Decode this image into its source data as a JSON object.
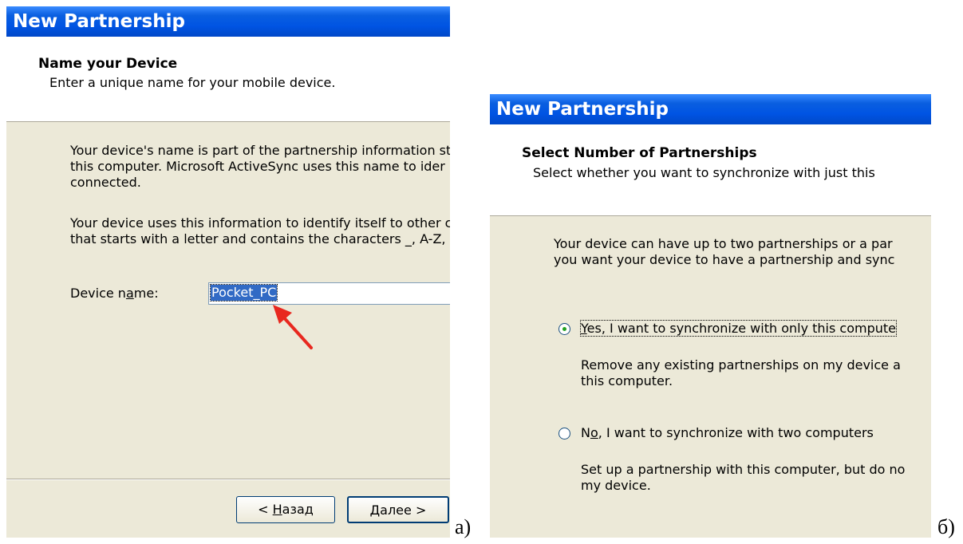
{
  "dialog_a": {
    "title": "New Partnership",
    "header_title": "Name your Device",
    "header_subtitle": "Enter a unique name for your mobile device.",
    "para1": [
      "Your device's name is part of the partnership information st",
      "this computer. Microsoft ActiveSync uses this name to ider",
      "connected."
    ],
    "para2": [
      "Your device uses this information to identify itself to other c",
      "that starts with a letter and contains the characters _, A-Z,"
    ],
    "device_label_pre": "Device n",
    "device_label_ul": "a",
    "device_label_post": "me:",
    "device_name_value": "Pocket_PC",
    "back_prefix": "< ",
    "back_ul": "Н",
    "back_rest": "азад",
    "next_ul": "Д",
    "next_rest": "алее >"
  },
  "dialog_b": {
    "title": "New Partnership",
    "header_title": "Select Number of Partnerships",
    "header_subtitle": "Select whether you want to synchronize with just this",
    "para1": [
      "Your device can have up to two partnerships or a par",
      "you want your device to have a partnership and sync"
    ],
    "option_yes_ul": "Y",
    "option_yes_rest": "es, I want to synchronize with only this compute",
    "option_yes_selected": true,
    "option_yes_desc": [
      "Remove any existing partnerships on my device a",
      "this computer."
    ],
    "option_no_pre": "N",
    "option_no_ul": "o",
    "option_no_rest": ", I want to synchronize with two computers",
    "option_no_desc": [
      "Set up a partnership with this computer, but do no",
      "my device."
    ]
  },
  "captions": {
    "a": "а)",
    "b": "б)"
  },
  "colors": {
    "titlebar": "#0054e3",
    "dialog_bg": "#ece9d8",
    "selection": "#316ac5",
    "arrow": "#e8281f"
  }
}
